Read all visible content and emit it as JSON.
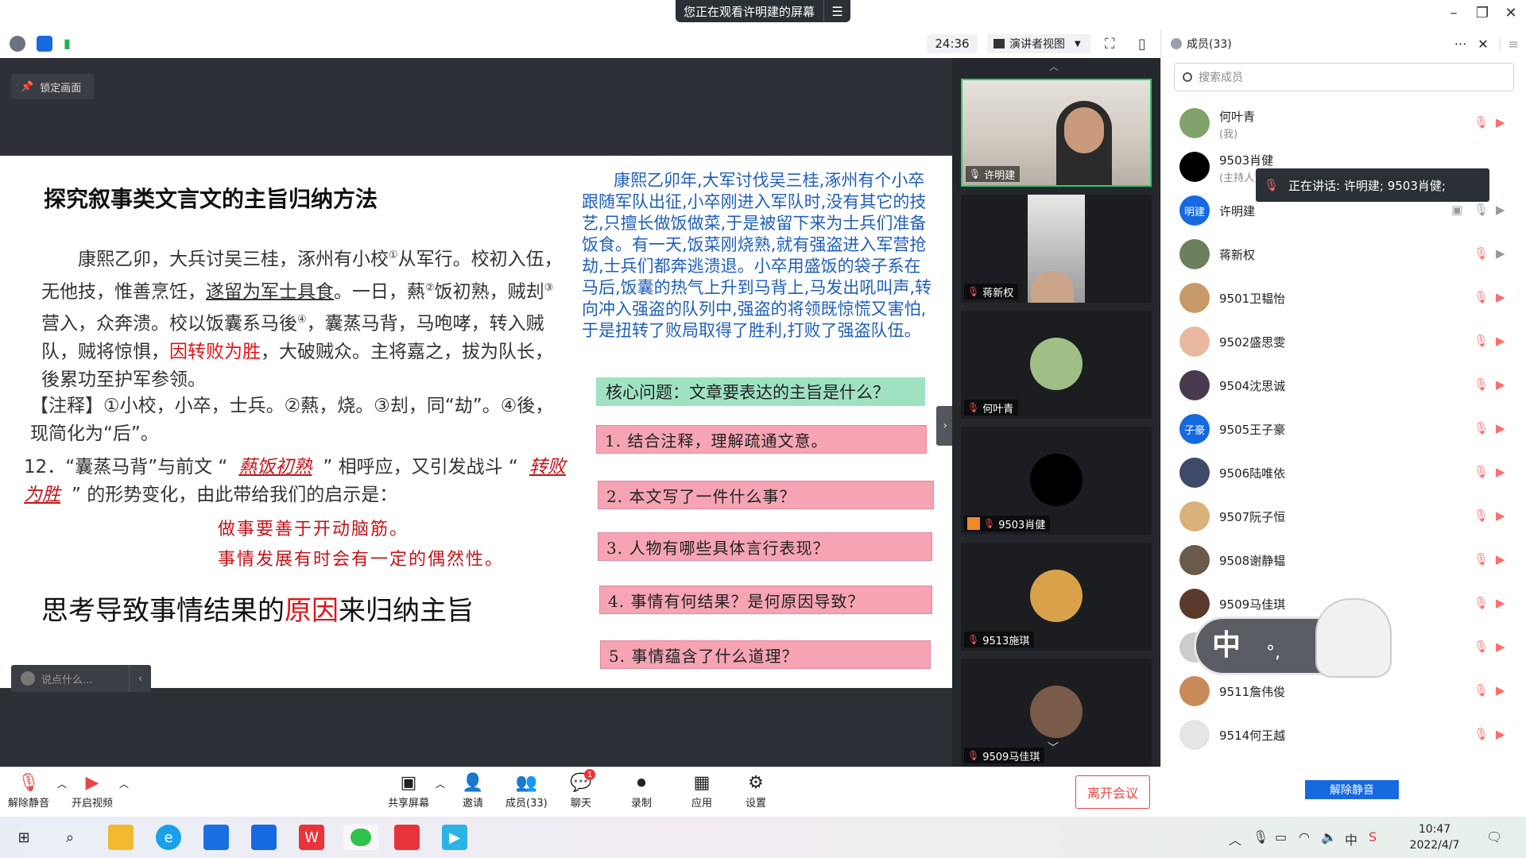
{
  "window": {
    "share_banner": "您正在观看许明建的屏幕",
    "minimize": "–",
    "restore": "❐",
    "close": "✕"
  },
  "toolbar": {
    "timer": "24:36",
    "view_label": "演讲者视图"
  },
  "stage": {
    "lock_label": "锁定画面",
    "chat_placeholder": "说点什么..."
  },
  "slide": {
    "title": "探究叙事类文言文的主旨归纳方法",
    "passage_1": "康熙乙卯，大兵讨吴三桂，涿州有小校",
    "passage_note_1": "①",
    "passage_2": "从军行。校初入伍，无他技，惟善烹饪，",
    "passage_underline": "遂留为军士具食",
    "passage_3": "。一日，爇",
    "passage_note_2": "②",
    "passage_4": "饭初熟，贼刦",
    "passage_note_3": "③",
    "passage_5": "营入，众奔溃。校以饭囊系马後",
    "passage_note_4": "④",
    "passage_6": "，囊蒸马背，马咆哮，转入贼队，贼将惊惧，",
    "passage_red": "因转败为胜",
    "passage_7": "，大破贼众。主将嘉之，拔为队长，後累功至护军参领。",
    "note": "【注释】①小校，小卒，士兵。②爇，烧。③刦，同“劫”。④後，现简化为“后”。",
    "q12_num": "12．",
    "q12_a": "“囊蒸马背”与前文 “",
    "q12_blank1": "爇饭初熟",
    "q12_b": "” 相呼应，又引发战斗 “",
    "q12_blank2": "转败为胜",
    "q12_c": "” 的形势变化，由此带给我们的启示是：",
    "answer_1": "做事要善于开动脑筋。",
    "answer_2": "事情发展有时会有一定的偶然性。",
    "conclusion_a": "思考导致事情结果的",
    "conclusion_red": "原因",
    "conclusion_b": "来归纳主旨",
    "translation": "康熙乙卯年,大军讨伐吴三桂,涿州有个小卒跟随军队出征,小卒刚进入军队时,没有其它的技艺,只擅长做饭做菜,于是被留下来为士兵们准备饭食。有一天,饭菜刚烧熟,就有强盗进入军营抢劫,士兵们都奔逃溃退。小卒用盛饭的袋子系在马后,饭囊的热气上升到马背上,马发出吼叫声,转向冲入强盗的队列中,强盗的将领既惊慌又害怕,于是扭转了败局取得了胜利,打败了强盗队伍。",
    "core_question": "核心问题：文章要表达的主旨是什么？",
    "questions": [
      "1. 结合注释，理解疏通文意。",
      "2. 本文写了一件什么事？",
      "3. 人物有哪些具体言行表现？",
      "4. 事情有何结果？是何原因导致？",
      "5. 事情蕴含了什么道理？"
    ]
  },
  "videos": [
    {
      "name": "许明建"
    },
    {
      "name": "蒋新权"
    },
    {
      "name": "何叶青"
    },
    {
      "name": "9503肖健"
    },
    {
      "name": "9513施琪"
    },
    {
      "name": "9509马佳琪"
    }
  ],
  "members_panel": {
    "title": "成员(33)",
    "more": "···",
    "close": "✕",
    "search_placeholder": "搜索成员",
    "speaking_tip": "正在讲话: 许明建; 9503肖健;",
    "unmute_all": "解除静音",
    "list": [
      {
        "name": "何叶青",
        "sub": "(我)",
        "avatar_color": "#7fa36b",
        "initials": ""
      },
      {
        "name": "9503肖健",
        "sub": "(主持人)",
        "avatar_color": "#000000",
        "initials": ""
      },
      {
        "name": "许明建",
        "sub": "",
        "avatar_color": "#1769e0",
        "initials": "明建"
      },
      {
        "name": "蒋新权",
        "sub": "",
        "avatar_color": "#6b7f5c",
        "initials": ""
      },
      {
        "name": "9501卫韫怡",
        "sub": "",
        "avatar_color": "#c79a6a",
        "initials": ""
      },
      {
        "name": "9502盛思雯",
        "sub": "",
        "avatar_color": "#e8b9a0",
        "initials": ""
      },
      {
        "name": "9504沈思诚",
        "sub": "",
        "avatar_color": "#4a3a4f",
        "initials": ""
      },
      {
        "name": "9505王子豪",
        "sub": "",
        "avatar_color": "#1769e0",
        "initials": "子豪"
      },
      {
        "name": "9506陆唯依",
        "sub": "",
        "avatar_color": "#3f4a6b",
        "initials": ""
      },
      {
        "name": "9507阮子恒",
        "sub": "",
        "avatar_color": "#d8b27a",
        "initials": ""
      },
      {
        "name": "9508谢静韫",
        "sub": "",
        "avatar_color": "#6b5a4a",
        "initials": ""
      },
      {
        "name": "9509马佳琪",
        "sub": "",
        "avatar_color": "#5a3a2a",
        "initials": ""
      },
      {
        "name": "",
        "sub": "",
        "avatar_color": "#cccccc",
        "initials": ""
      },
      {
        "name": "9511詹伟俊",
        "sub": "",
        "avatar_color": "#c98a5a",
        "initials": ""
      },
      {
        "name": "9514何王越",
        "sub": "",
        "avatar_color": "#e5e5e5",
        "initials": ""
      }
    ]
  },
  "ime": {
    "mode": "中",
    "punct": "°,"
  },
  "controls": {
    "unmute": "解除静音",
    "start_video": "开启视频",
    "share_screen": "共享屏幕",
    "invite": "邀请",
    "members": "成员(33)",
    "chat": "聊天",
    "chat_badge": "1",
    "record": "录制",
    "apps": "应用",
    "settings": "设置",
    "leave": "离开会议"
  },
  "taskbar": {
    "time": "10:47",
    "date": "2022/4/7",
    "ime_tray": "中"
  }
}
